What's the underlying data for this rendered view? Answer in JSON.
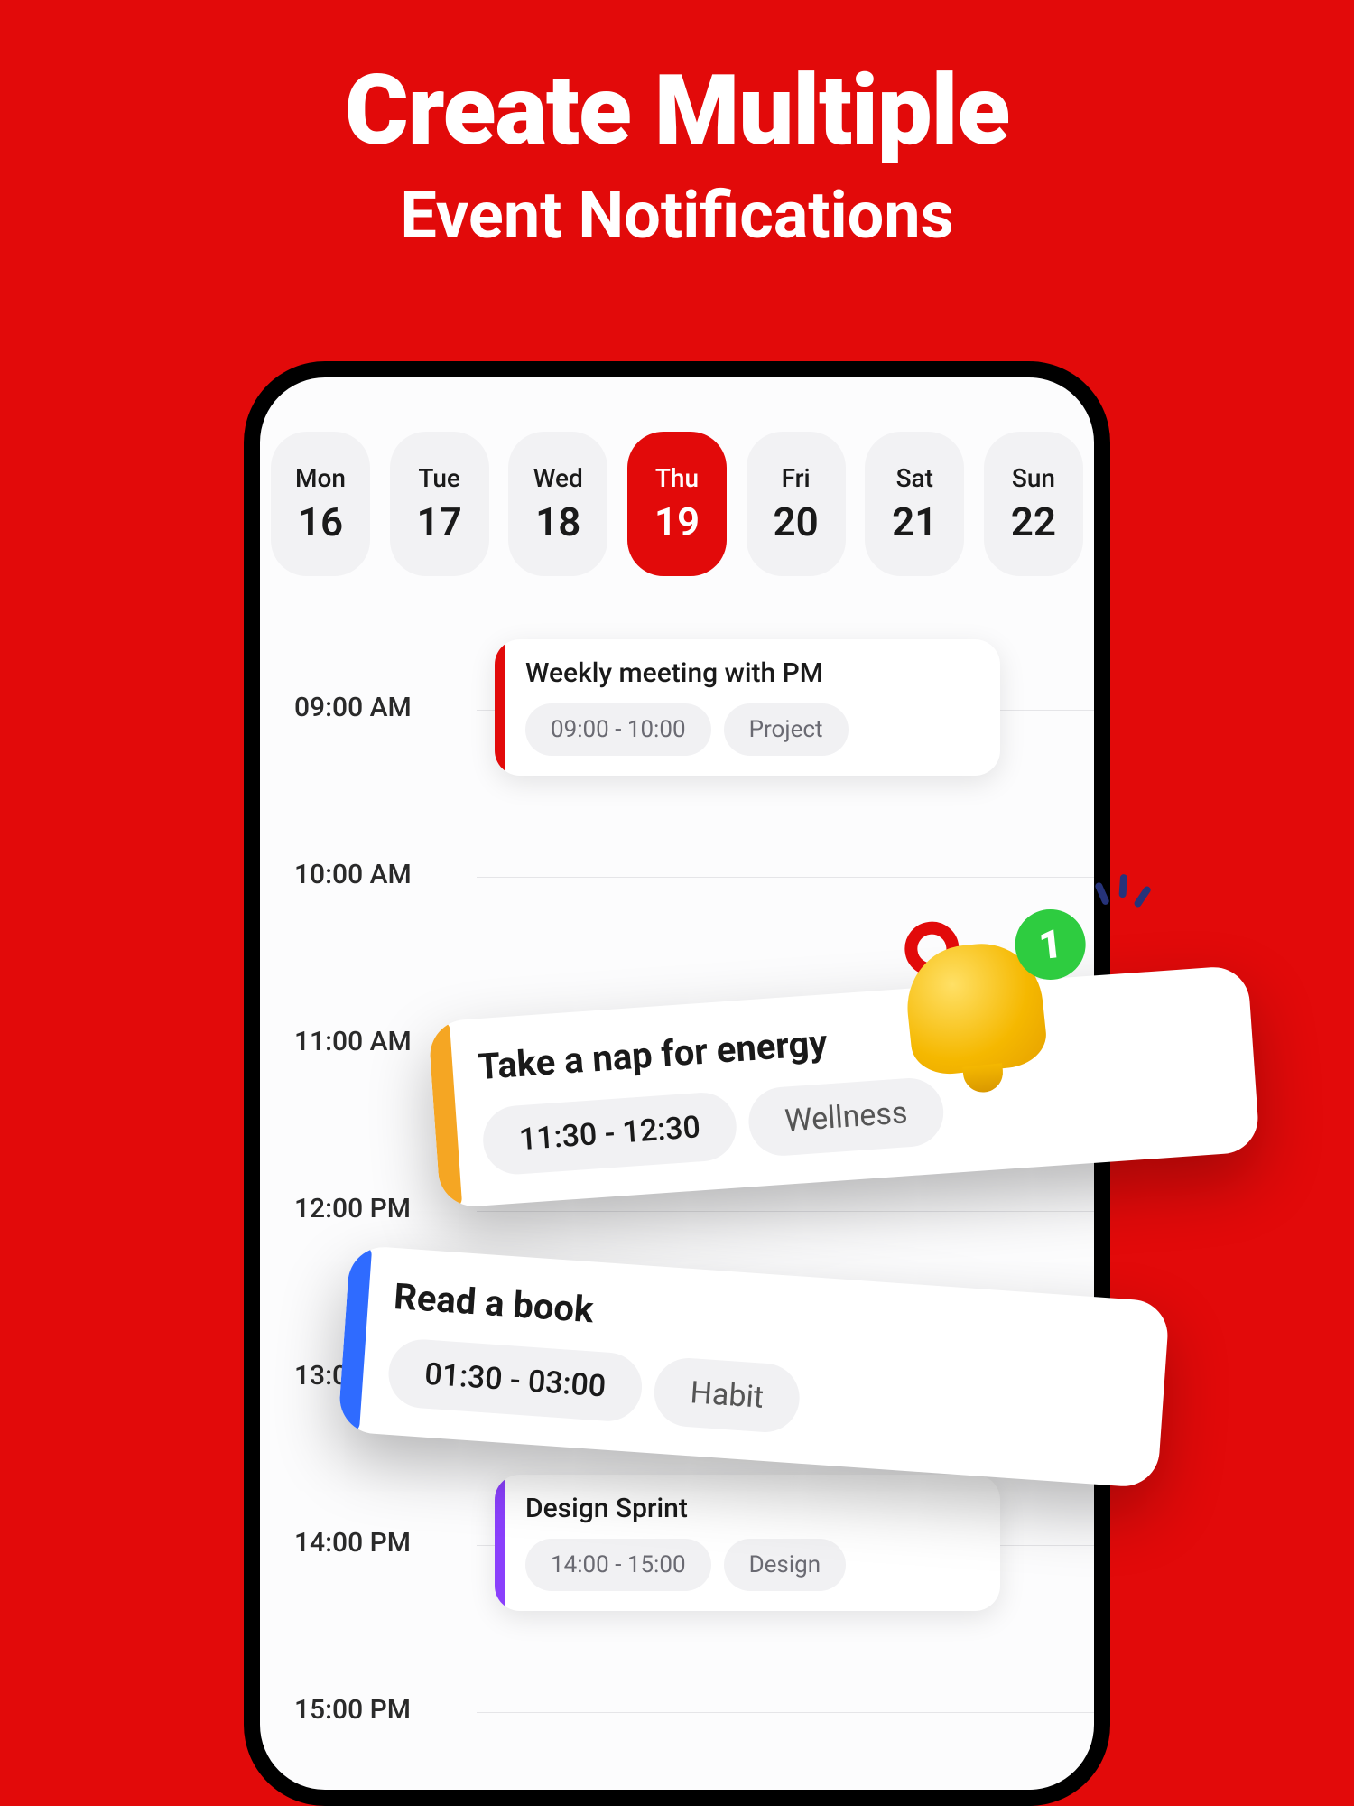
{
  "hero": {
    "title": "Create Multiple",
    "subtitle": "Event Notifications"
  },
  "days": [
    {
      "dow": "Mon",
      "num": "16",
      "selected": false
    },
    {
      "dow": "Tue",
      "num": "17",
      "selected": false
    },
    {
      "dow": "Wed",
      "num": "18",
      "selected": false
    },
    {
      "dow": "Thu",
      "num": "19",
      "selected": true
    },
    {
      "dow": "Fri",
      "num": "20",
      "selected": false
    },
    {
      "dow": "Sat",
      "num": "21",
      "selected": false
    },
    {
      "dow": "Sun",
      "num": "22",
      "selected": false
    }
  ],
  "hours": [
    "09:00 AM",
    "10:00 AM",
    "11:00 AM",
    "12:00 PM",
    "13:00 PM",
    "14:00 PM",
    "15:00 PM"
  ],
  "events": {
    "meeting": {
      "title": "Weekly meeting with PM",
      "time": "09:00 - 10:00",
      "tag": "Project",
      "color": "#e20a0a"
    },
    "nap": {
      "title": "Take a nap for energy",
      "time": "11:30 - 12:30",
      "tag": "Wellness",
      "color": "#f5a623"
    },
    "read": {
      "title": "Read a book",
      "time": "01:30 - 03:00",
      "tag": "Habit",
      "color": "#2f6bff"
    },
    "design": {
      "title": "Design Sprint",
      "time": "14:00 - 15:00",
      "tag": "Design",
      "color": "#8a3ffc"
    }
  },
  "bell_badge": "1"
}
